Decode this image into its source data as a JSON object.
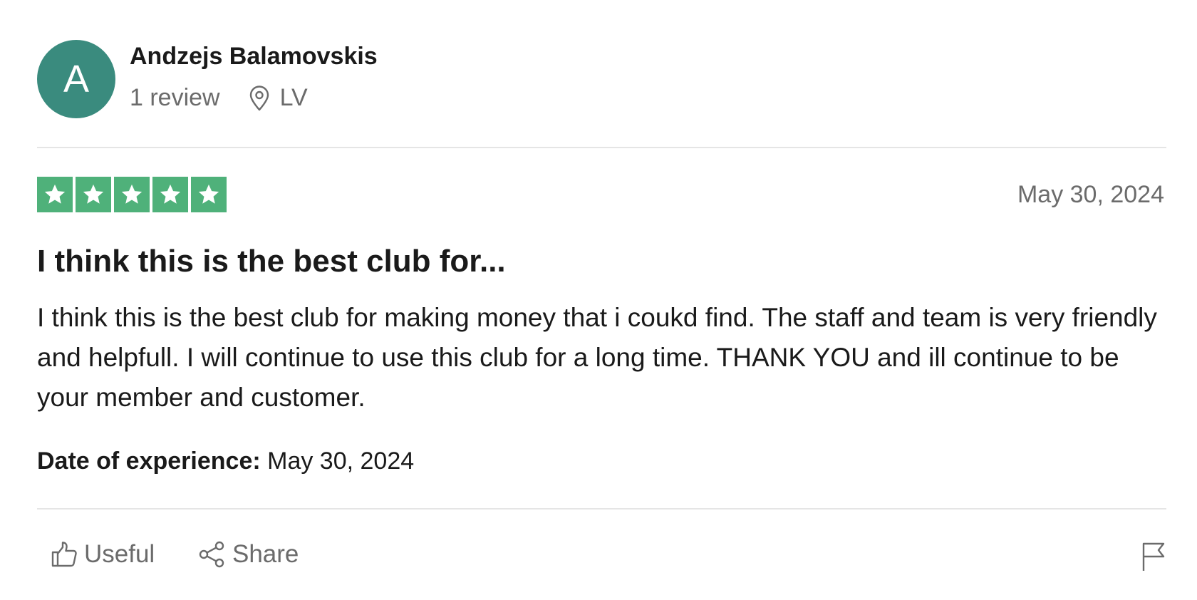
{
  "reviewer": {
    "avatar_letter": "A",
    "avatar_color": "#3a8b7e",
    "name": "Andzejs Balamovskis",
    "review_count": "1 review",
    "location": "LV"
  },
  "review": {
    "rating": 5,
    "max_rating": 5,
    "star_color": "#4fb17a",
    "date": "May 30, 2024",
    "title": "I think this is the best club for...",
    "body": "I think this is the best club for making money that i coukd find. The staff and team is very friendly and helpfull. I will continue to use this club for a long time. THANK YOU and ill continue to be your member and customer.",
    "experience_label": "Date of experience:",
    "experience_date": "May 30, 2024"
  },
  "actions": {
    "useful_label": "Useful",
    "share_label": "Share",
    "useful_icon": "thumbs-up-icon",
    "share_icon": "share-icon",
    "report_icon": "flag-icon"
  }
}
